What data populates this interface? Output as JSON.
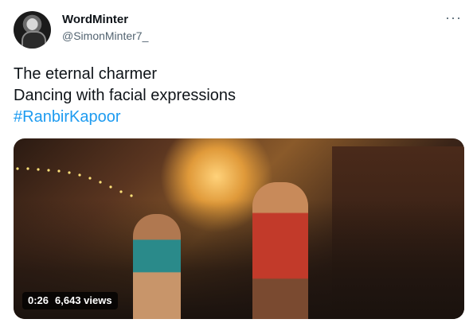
{
  "user": {
    "name": "WordMinter",
    "handle": "@SimonMinter7_"
  },
  "menu_glyph": "···",
  "tweet": {
    "lines": [
      "The eternal charmer",
      "Dancing with facial expressions"
    ],
    "hashtag": "#RanbirKapoor"
  },
  "media": {
    "duration": "0:26",
    "views": "6,643 views"
  },
  "colors": {
    "accent": "#1d9bf0",
    "text": "#0f1419",
    "secondary": "#536471"
  }
}
